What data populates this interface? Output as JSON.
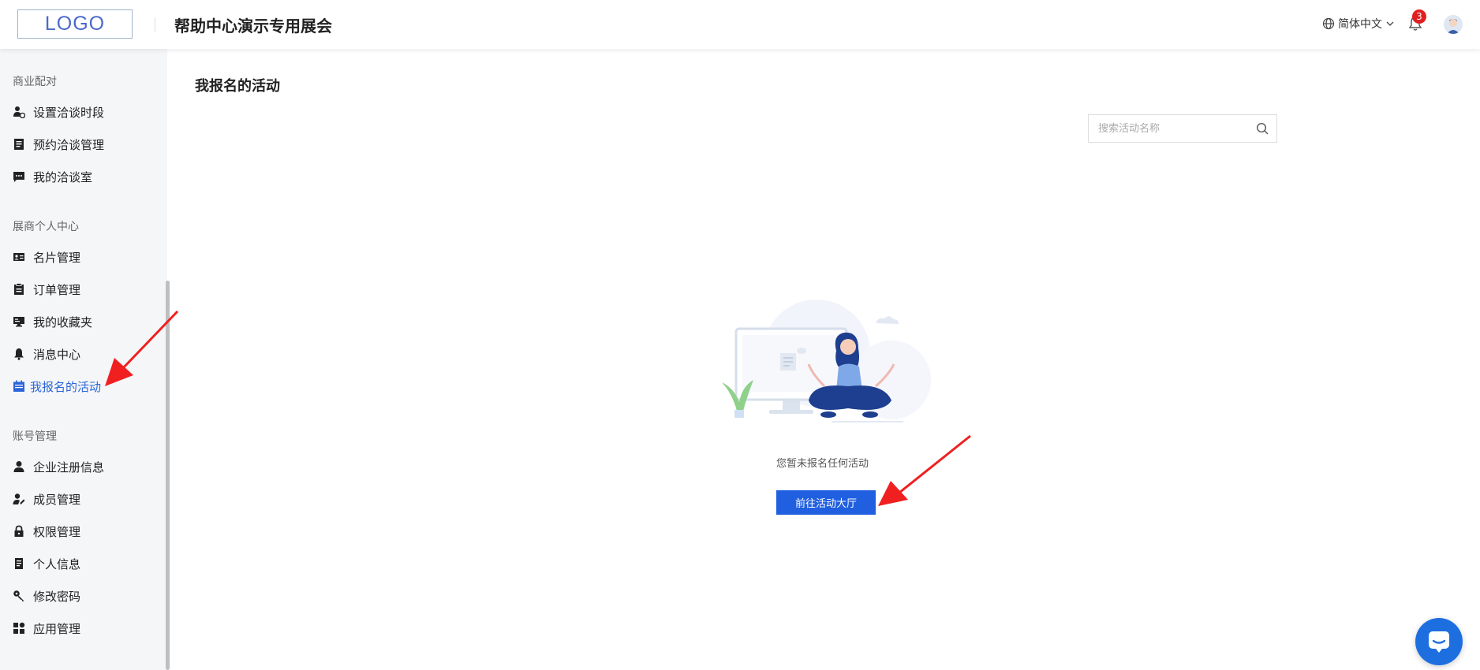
{
  "header": {
    "logo_text": "LOGO",
    "site_title": "帮助中心演示专用展会",
    "language": "简体中文",
    "notification_count": "3"
  },
  "sidebar": {
    "groups": [
      {
        "title": "商业配对",
        "items": [
          {
            "label": "设置洽谈时段",
            "icon": "person-clock-icon"
          },
          {
            "label": "预约洽谈管理",
            "icon": "clipboard-list-icon"
          },
          {
            "label": "我的洽谈室",
            "icon": "chat-icon"
          }
        ]
      },
      {
        "title": "展商个人中心",
        "items": [
          {
            "label": "名片管理",
            "icon": "id-card-icon"
          },
          {
            "label": "订单管理",
            "icon": "clipboard-icon"
          },
          {
            "label": "我的收藏夹",
            "icon": "monitor-icon"
          },
          {
            "label": "消息中心",
            "icon": "bell-icon"
          },
          {
            "label": "我报名的活动",
            "icon": "calendar-icon",
            "active": true
          }
        ]
      },
      {
        "title": "账号管理",
        "items": [
          {
            "label": "企业注册信息",
            "icon": "person-icon"
          },
          {
            "label": "成员管理",
            "icon": "person-edit-icon"
          },
          {
            "label": "权限管理",
            "icon": "lock-icon"
          },
          {
            "label": "个人信息",
            "icon": "document-icon"
          },
          {
            "label": "修改密码",
            "icon": "key-icon"
          },
          {
            "label": "应用管理",
            "icon": "apps-grid-icon"
          }
        ]
      }
    ]
  },
  "main": {
    "page_title": "我报名的活动",
    "search_placeholder": "搜索活动名称",
    "empty_message": "您暂未报名任何活动",
    "cta_label": "前往活动大厅"
  },
  "colors": {
    "accent": "#1f5fe0",
    "active_nav": "#2b66d9",
    "badge": "#e02020",
    "annotation_arrow": "#f02020"
  }
}
